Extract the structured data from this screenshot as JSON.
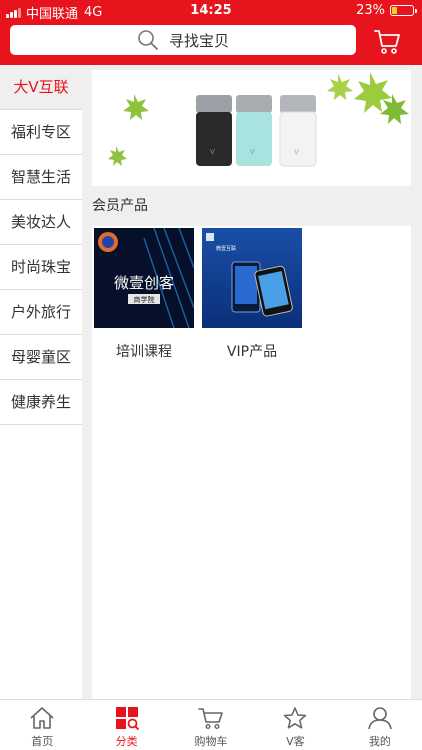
{
  "status_bar": {
    "carrier": "中国联通",
    "network": "4G",
    "time": "14:25",
    "battery": "23%",
    "battery_level": 0.23
  },
  "search": {
    "placeholder": "寻找宝贝"
  },
  "sidebar": {
    "items": [
      {
        "label": "大V互联",
        "active": true
      },
      {
        "label": "福利专区"
      },
      {
        "label": "智慧生活"
      },
      {
        "label": "美妆达人"
      },
      {
        "label": "时尚珠宝"
      },
      {
        "label": "户外旅行"
      },
      {
        "label": "母婴童区"
      },
      {
        "label": "健康养生"
      }
    ]
  },
  "main": {
    "section_title": "会员产品",
    "products": [
      {
        "name": "培训课程",
        "thumb_text": "微壹创客",
        "thumb_sub": "商学院"
      },
      {
        "name": "VIP产品",
        "thumb_text": "微壹互联"
      }
    ]
  },
  "tabbar": {
    "items": [
      {
        "label": "首页",
        "icon": "home-icon"
      },
      {
        "label": "分类",
        "icon": "category-icon",
        "active": true
      },
      {
        "label": "购物车",
        "icon": "cart-icon"
      },
      {
        "label": "V客",
        "icon": "star-icon"
      },
      {
        "label": "我的",
        "icon": "user-icon"
      }
    ]
  },
  "colors": {
    "brand": "#e8141d",
    "background": "#efefef"
  }
}
